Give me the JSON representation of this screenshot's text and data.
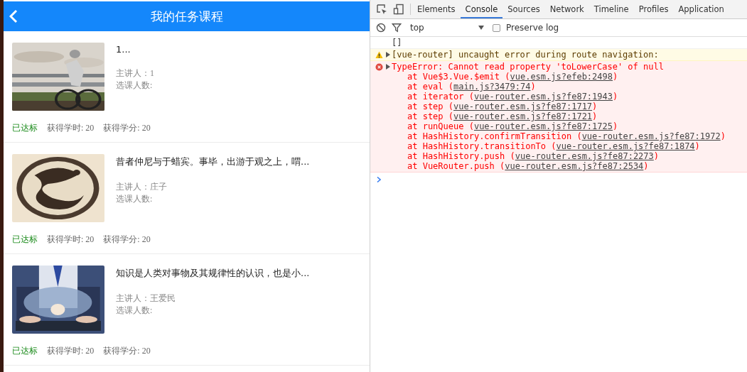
{
  "app": {
    "title": "我的任务课程",
    "courses": [
      {
        "title": "1...",
        "lecturer": "主讲人：1",
        "enrolled": "选课人数:",
        "status": "已达标",
        "hours": "获得学时: 20",
        "credits": "获得学分: 20"
      },
      {
        "title": "昔者仲尼与于蜡宾。事毕，出游于观之上，喟...",
        "lecturer": "主讲人：庄子",
        "enrolled": "选课人数:",
        "status": "已达标",
        "hours": "获得学时: 20",
        "credits": "获得学分: 20"
      },
      {
        "title": "知识是人类对事物及其规律性的认识，也是小...",
        "lecturer": "主讲人：王爱民",
        "enrolled": "选课人数:",
        "status": "已达标",
        "hours": "获得学时: 20",
        "credits": "获得学分: 20"
      }
    ]
  },
  "devtools": {
    "tabs": [
      {
        "label": "Elements",
        "selected": false
      },
      {
        "label": "Console",
        "selected": true
      },
      {
        "label": "Sources",
        "selected": false
      },
      {
        "label": "Network",
        "selected": false
      },
      {
        "label": "Timeline",
        "selected": false
      },
      {
        "label": "Profiles",
        "selected": false
      },
      {
        "label": "Application",
        "selected": false
      }
    ],
    "context": "top",
    "preserve_log": {
      "label": "Preserve log",
      "checked": false
    },
    "messages": [
      {
        "kind": "log",
        "text": "[]"
      },
      {
        "kind": "warning",
        "text": "[vue-router] uncaught error during route navigation:"
      },
      {
        "kind": "error",
        "text": "TypeError: Cannot read property 'toLowerCase' of null",
        "stack": [
          {
            "before": "at Vue$3.Vue.$emit (",
            "link": "vue.esm.js?efeb:2498",
            "after": ")"
          },
          {
            "before": "at eval (",
            "link": "main.js?3479:74",
            "after": ")"
          },
          {
            "before": "at iterator (",
            "link": "vue-router.esm.js?fe87:1943",
            "after": ")"
          },
          {
            "before": "at step (",
            "link": "vue-router.esm.js?fe87:1717",
            "after": ")"
          },
          {
            "before": "at step (",
            "link": "vue-router.esm.js?fe87:1721",
            "after": ")"
          },
          {
            "before": "at runQueue (",
            "link": "vue-router.esm.js?fe87:1725",
            "after": ")"
          },
          {
            "before": "at HashHistory.confirmTransition (",
            "link": "vue-router.esm.js?fe87:1972",
            "after": ")"
          },
          {
            "before": "at HashHistory.transitionTo (",
            "link": "vue-router.esm.js?fe87:1874",
            "after": ")"
          },
          {
            "before": "at HashHistory.push (",
            "link": "vue-router.esm.js?fe87:2273",
            "after": ")"
          },
          {
            "before": "at VueRouter.push (",
            "link": "vue-router.esm.js?fe87:2534",
            "after": ")"
          }
        ]
      }
    ]
  }
}
